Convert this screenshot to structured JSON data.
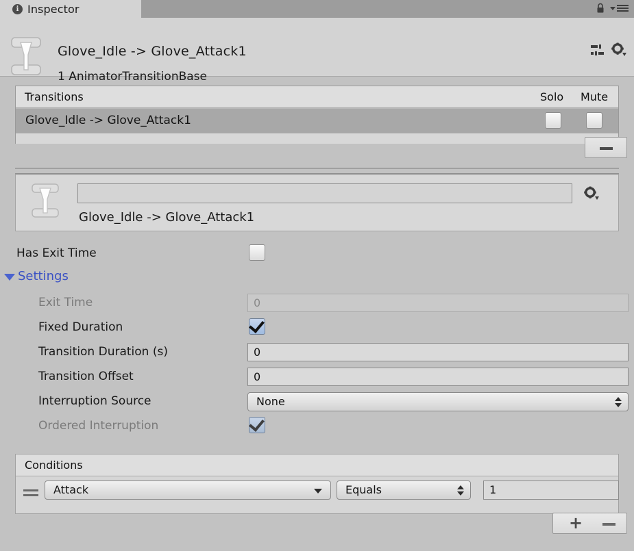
{
  "window": {
    "tab_label": "Inspector",
    "tab_icon": "info-icon",
    "lock_icon": "lock-icon",
    "menu_icon": "hamburger-menu-icon"
  },
  "header": {
    "title": "Glove_Idle -> Glove_Attack1",
    "subtitle": "1 AnimatorTransitionBase",
    "object_icon": "animator-transition-icon",
    "preset_icon": "preset-icon",
    "gear_icon": "gear-icon"
  },
  "transitions": {
    "header_label": "Transitions",
    "solo_label": "Solo",
    "mute_label": "Mute",
    "rows": [
      {
        "name": "Glove_Idle -> Glove_Attack1",
        "solo": false,
        "mute": false,
        "selected": true
      }
    ],
    "remove_button": "remove-transition-button"
  },
  "transition_panel": {
    "name_value": "",
    "name_placeholder": "",
    "display_name": "Glove_Idle -> Glove_Attack1",
    "icon": "animator-transition-icon",
    "gear_icon": "gear-icon"
  },
  "properties": {
    "has_exit_time": {
      "label": "Has Exit Time",
      "checked": false,
      "disabled": false
    },
    "settings_foldout": {
      "label": "Settings",
      "expanded": true,
      "color": "#3a51c4"
    },
    "exit_time": {
      "label": "Exit Time",
      "value": "0",
      "disabled": true
    },
    "fixed_duration": {
      "label": "Fixed Duration",
      "checked": true,
      "disabled": false
    },
    "transition_duration": {
      "label": "Transition Duration (s)",
      "value": "0",
      "disabled": false
    },
    "transition_offset": {
      "label": "Transition Offset",
      "value": "0",
      "disabled": false
    },
    "interruption_source": {
      "label": "Interruption Source",
      "value": "None",
      "disabled": false
    },
    "ordered_interruption": {
      "label": "Ordered Interruption",
      "checked": true,
      "disabled": true
    }
  },
  "conditions": {
    "header_label": "Conditions",
    "rows": [
      {
        "parameter": "Attack",
        "comparison": "Equals",
        "threshold": "1"
      }
    ],
    "add_label": "+",
    "remove_label": "-"
  },
  "colors": {
    "window_bg": "#c2c2c2",
    "panel_bg": "#d3d3d3",
    "tabbar_bg": "#9d9d9d",
    "row_selected": "#a8a8a8",
    "accent_blue": "#3a51c4",
    "checkbox_checked": "#9fbbe0"
  }
}
